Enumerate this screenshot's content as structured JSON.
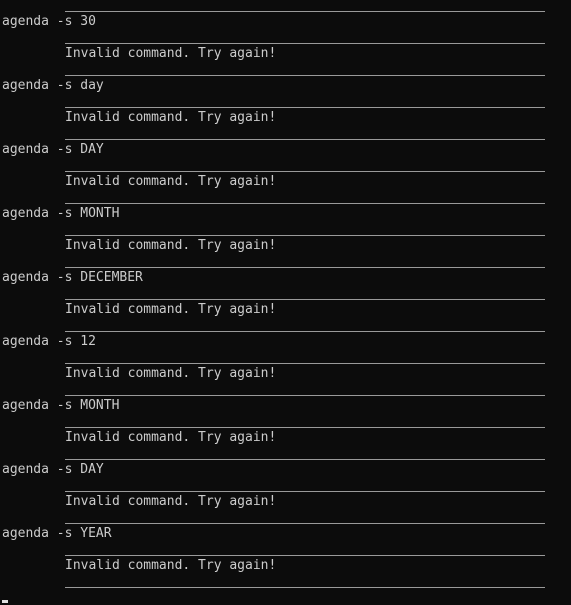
{
  "terminal": {
    "entries": [
      {
        "command": "agenda -s 30",
        "response": "Invalid command. Try again!"
      },
      {
        "command": "agenda -s day",
        "response": "Invalid command. Try again!"
      },
      {
        "command": "agenda -s DAY",
        "response": "Invalid command. Try again!"
      },
      {
        "command": "agenda -s MONTH",
        "response": "Invalid command. Try again!"
      },
      {
        "command": "agenda -s DECEMBER",
        "response": "Invalid command. Try again!"
      },
      {
        "command": "agenda -s 12",
        "response": "Invalid command. Try again!"
      },
      {
        "command": "agenda -s MONTH",
        "response": "Invalid command. Try again!"
      },
      {
        "command": "agenda -s DAY",
        "response": "Invalid command. Try again!"
      },
      {
        "command": "agenda -s YEAR",
        "response": "Invalid command. Try again!"
      }
    ]
  },
  "colors": {
    "background": "#0c0c0c",
    "text": "#cccccc",
    "divider": "#9a9a9a"
  }
}
